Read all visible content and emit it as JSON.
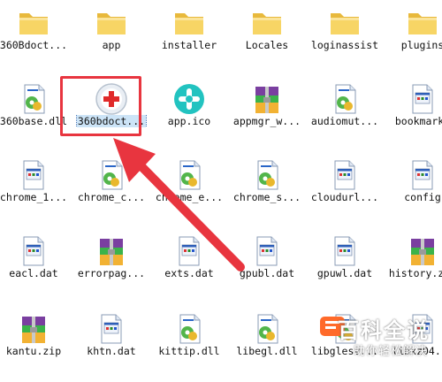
{
  "files": [
    {
      "label": "360Bdoct...",
      "type": "folder"
    },
    {
      "label": "app",
      "type": "folder"
    },
    {
      "label": "installer",
      "type": "folder"
    },
    {
      "label": "Locales",
      "type": "folder"
    },
    {
      "label": "loginassist",
      "type": "folder"
    },
    {
      "label": "plugins",
      "type": "folder"
    },
    {
      "label": "360base.dll",
      "type": "dll"
    },
    {
      "label": "360bdoct...",
      "type": "exe-360",
      "selected": true
    },
    {
      "label": "app.ico",
      "type": "ico"
    },
    {
      "label": "appmgr_w...",
      "type": "archive"
    },
    {
      "label": "audiomut...",
      "type": "dll"
    },
    {
      "label": "bookmarks",
      "type": "doc"
    },
    {
      "label": "chrome_1...",
      "type": "doc"
    },
    {
      "label": "chrome_c...",
      "type": "dll"
    },
    {
      "label": "chrome_e...",
      "type": "dll"
    },
    {
      "label": "chrome_s...",
      "type": "dll"
    },
    {
      "label": "cloudurl...",
      "type": "doc"
    },
    {
      "label": "config",
      "type": "doc"
    },
    {
      "label": "eacl.dat",
      "type": "doc"
    },
    {
      "label": "errorpag...",
      "type": "archive"
    },
    {
      "label": "exts.dat",
      "type": "doc"
    },
    {
      "label": "gpubl.dat",
      "type": "doc"
    },
    {
      "label": "gpuwl.dat",
      "type": "doc"
    },
    {
      "label": "history.zip",
      "type": "archive"
    },
    {
      "label": "kantu.zip",
      "type": "archive"
    },
    {
      "label": "khtn.dat",
      "type": "doc"
    },
    {
      "label": "kittip.dll",
      "type": "dll"
    },
    {
      "label": "libegl.dll",
      "type": "dll"
    },
    {
      "label": "libglesv...",
      "type": "dll"
    },
    {
      "label": "libxz04...",
      "type": "doc"
    }
  ],
  "watermark": {
    "title": "百科全说",
    "subtitle": "助你轻松解决"
  },
  "colors": {
    "selection_border": "#e8353f",
    "arrow": "#e8353f",
    "folder": "#f5cf57"
  }
}
